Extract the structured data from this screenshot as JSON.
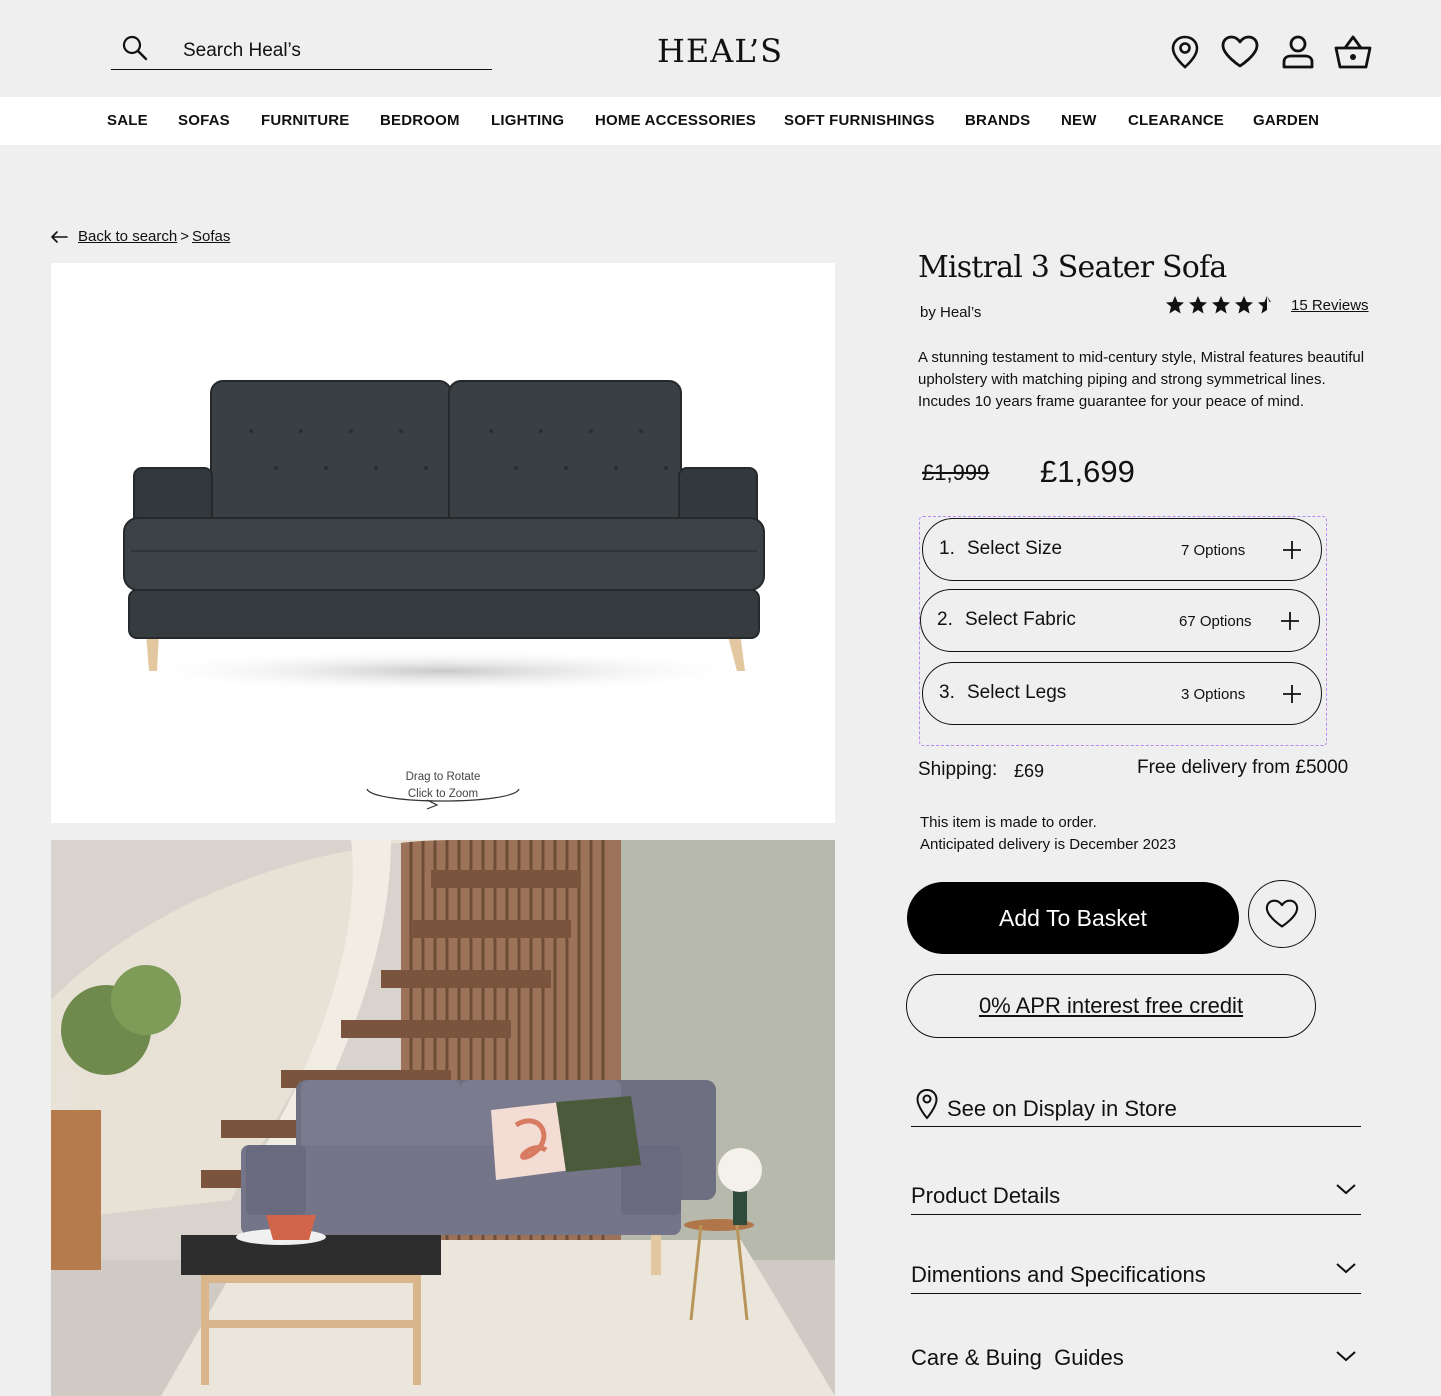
{
  "header": {
    "search_placeholder": "Search Heal’s",
    "logo": "HEAL’S",
    "icons": [
      "location-icon",
      "heart-icon",
      "account-icon",
      "basket-icon"
    ]
  },
  "nav": {
    "items": [
      "SALE",
      "SOFAS",
      "FURNITURE",
      "BEDROOM",
      "LIGHTING",
      "HOME ACCESSORIES",
      "SOFT FURNISHINGS",
      "BRANDS",
      "NEW",
      "CLEARANCE",
      "GARDEN"
    ]
  },
  "breadcrumb": {
    "back": "Back to search",
    "separator": ">",
    "current": "Sofas"
  },
  "gallery": {
    "hint_line1": "Drag to Rotate",
    "hint_line2": "Click to Zoom"
  },
  "product": {
    "title": "Mistral 3 Seater Sofa",
    "brand": "by Heal’s",
    "rating": 4.5,
    "reviews": "15 Reviews",
    "description": "A stunning testament to mid-century style, Mistral features beautiful upholstery with matching piping and strong symmetrical lines. Incudes 10 years frame guarantee for your peace of mind.",
    "price_old": "£1,999",
    "price_new": "£1,699"
  },
  "options": [
    {
      "num": "1.",
      "label": "Select Size",
      "count": "7 Options"
    },
    {
      "num": "2.",
      "label": "Select Fabric",
      "count": "67 Options"
    },
    {
      "num": "3.",
      "label": "Select Legs",
      "count": "3 Options"
    }
  ],
  "shipping": {
    "label": "Shipping:",
    "value": "£69",
    "free": "Free delivery from £5000"
  },
  "made_to_order": {
    "line1": "This item is made to order.",
    "line2": "Anticipated delivery is December 2023"
  },
  "actions": {
    "basket": "Add To Basket",
    "credit": "0% APR interest free credit",
    "store": "See on Display in Store"
  },
  "accordions": [
    "Product Details",
    "Dimentions and Specifications",
    "Care & Buing  Guides"
  ],
  "colors": {
    "background": "#efefef",
    "nav": "#ffffff",
    "primary": "#000000",
    "dashed_outline": "#b48cf0"
  }
}
